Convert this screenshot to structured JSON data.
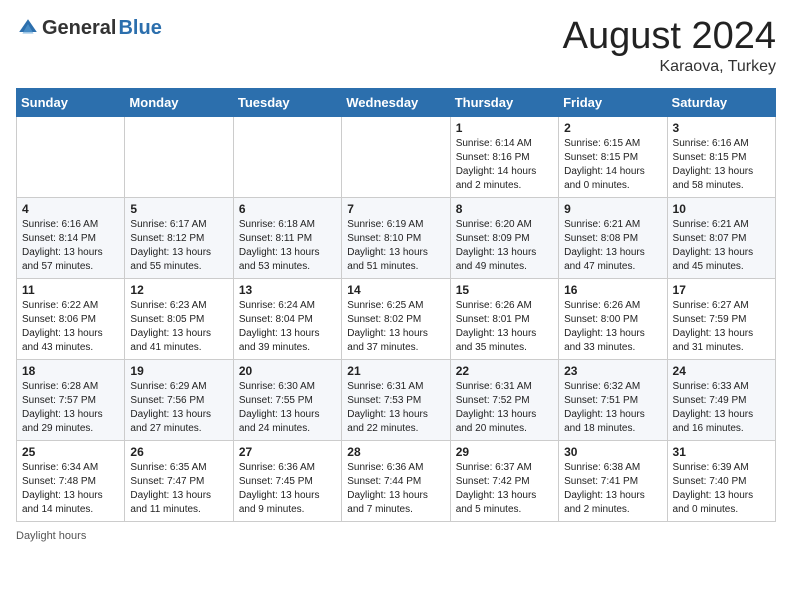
{
  "header": {
    "logo_general": "General",
    "logo_blue": "Blue",
    "month_title": "August 2024",
    "location": "Karaova, Turkey"
  },
  "calendar": {
    "columns": [
      "Sunday",
      "Monday",
      "Tuesday",
      "Wednesday",
      "Thursday",
      "Friday",
      "Saturday"
    ],
    "weeks": [
      [
        {
          "day": "",
          "info": ""
        },
        {
          "day": "",
          "info": ""
        },
        {
          "day": "",
          "info": ""
        },
        {
          "day": "",
          "info": ""
        },
        {
          "day": "1",
          "info": "Sunrise: 6:14 AM\nSunset: 8:16 PM\nDaylight: 14 hours\nand 2 minutes."
        },
        {
          "day": "2",
          "info": "Sunrise: 6:15 AM\nSunset: 8:15 PM\nDaylight: 14 hours\nand 0 minutes."
        },
        {
          "day": "3",
          "info": "Sunrise: 6:16 AM\nSunset: 8:15 PM\nDaylight: 13 hours\nand 58 minutes."
        }
      ],
      [
        {
          "day": "4",
          "info": "Sunrise: 6:16 AM\nSunset: 8:14 PM\nDaylight: 13 hours\nand 57 minutes."
        },
        {
          "day": "5",
          "info": "Sunrise: 6:17 AM\nSunset: 8:12 PM\nDaylight: 13 hours\nand 55 minutes."
        },
        {
          "day": "6",
          "info": "Sunrise: 6:18 AM\nSunset: 8:11 PM\nDaylight: 13 hours\nand 53 minutes."
        },
        {
          "day": "7",
          "info": "Sunrise: 6:19 AM\nSunset: 8:10 PM\nDaylight: 13 hours\nand 51 minutes."
        },
        {
          "day": "8",
          "info": "Sunrise: 6:20 AM\nSunset: 8:09 PM\nDaylight: 13 hours\nand 49 minutes."
        },
        {
          "day": "9",
          "info": "Sunrise: 6:21 AM\nSunset: 8:08 PM\nDaylight: 13 hours\nand 47 minutes."
        },
        {
          "day": "10",
          "info": "Sunrise: 6:21 AM\nSunset: 8:07 PM\nDaylight: 13 hours\nand 45 minutes."
        }
      ],
      [
        {
          "day": "11",
          "info": "Sunrise: 6:22 AM\nSunset: 8:06 PM\nDaylight: 13 hours\nand 43 minutes."
        },
        {
          "day": "12",
          "info": "Sunrise: 6:23 AM\nSunset: 8:05 PM\nDaylight: 13 hours\nand 41 minutes."
        },
        {
          "day": "13",
          "info": "Sunrise: 6:24 AM\nSunset: 8:04 PM\nDaylight: 13 hours\nand 39 minutes."
        },
        {
          "day": "14",
          "info": "Sunrise: 6:25 AM\nSunset: 8:02 PM\nDaylight: 13 hours\nand 37 minutes."
        },
        {
          "day": "15",
          "info": "Sunrise: 6:26 AM\nSunset: 8:01 PM\nDaylight: 13 hours\nand 35 minutes."
        },
        {
          "day": "16",
          "info": "Sunrise: 6:26 AM\nSunset: 8:00 PM\nDaylight: 13 hours\nand 33 minutes."
        },
        {
          "day": "17",
          "info": "Sunrise: 6:27 AM\nSunset: 7:59 PM\nDaylight: 13 hours\nand 31 minutes."
        }
      ],
      [
        {
          "day": "18",
          "info": "Sunrise: 6:28 AM\nSunset: 7:57 PM\nDaylight: 13 hours\nand 29 minutes."
        },
        {
          "day": "19",
          "info": "Sunrise: 6:29 AM\nSunset: 7:56 PM\nDaylight: 13 hours\nand 27 minutes."
        },
        {
          "day": "20",
          "info": "Sunrise: 6:30 AM\nSunset: 7:55 PM\nDaylight: 13 hours\nand 24 minutes."
        },
        {
          "day": "21",
          "info": "Sunrise: 6:31 AM\nSunset: 7:53 PM\nDaylight: 13 hours\nand 22 minutes."
        },
        {
          "day": "22",
          "info": "Sunrise: 6:31 AM\nSunset: 7:52 PM\nDaylight: 13 hours\nand 20 minutes."
        },
        {
          "day": "23",
          "info": "Sunrise: 6:32 AM\nSunset: 7:51 PM\nDaylight: 13 hours\nand 18 minutes."
        },
        {
          "day": "24",
          "info": "Sunrise: 6:33 AM\nSunset: 7:49 PM\nDaylight: 13 hours\nand 16 minutes."
        }
      ],
      [
        {
          "day": "25",
          "info": "Sunrise: 6:34 AM\nSunset: 7:48 PM\nDaylight: 13 hours\nand 14 minutes."
        },
        {
          "day": "26",
          "info": "Sunrise: 6:35 AM\nSunset: 7:47 PM\nDaylight: 13 hours\nand 11 minutes."
        },
        {
          "day": "27",
          "info": "Sunrise: 6:36 AM\nSunset: 7:45 PM\nDaylight: 13 hours\nand 9 minutes."
        },
        {
          "day": "28",
          "info": "Sunrise: 6:36 AM\nSunset: 7:44 PM\nDaylight: 13 hours\nand 7 minutes."
        },
        {
          "day": "29",
          "info": "Sunrise: 6:37 AM\nSunset: 7:42 PM\nDaylight: 13 hours\nand 5 minutes."
        },
        {
          "day": "30",
          "info": "Sunrise: 6:38 AM\nSunset: 7:41 PM\nDaylight: 13 hours\nand 2 minutes."
        },
        {
          "day": "31",
          "info": "Sunrise: 6:39 AM\nSunset: 7:40 PM\nDaylight: 13 hours\nand 0 minutes."
        }
      ]
    ]
  },
  "footer": {
    "text": "Daylight hours"
  }
}
